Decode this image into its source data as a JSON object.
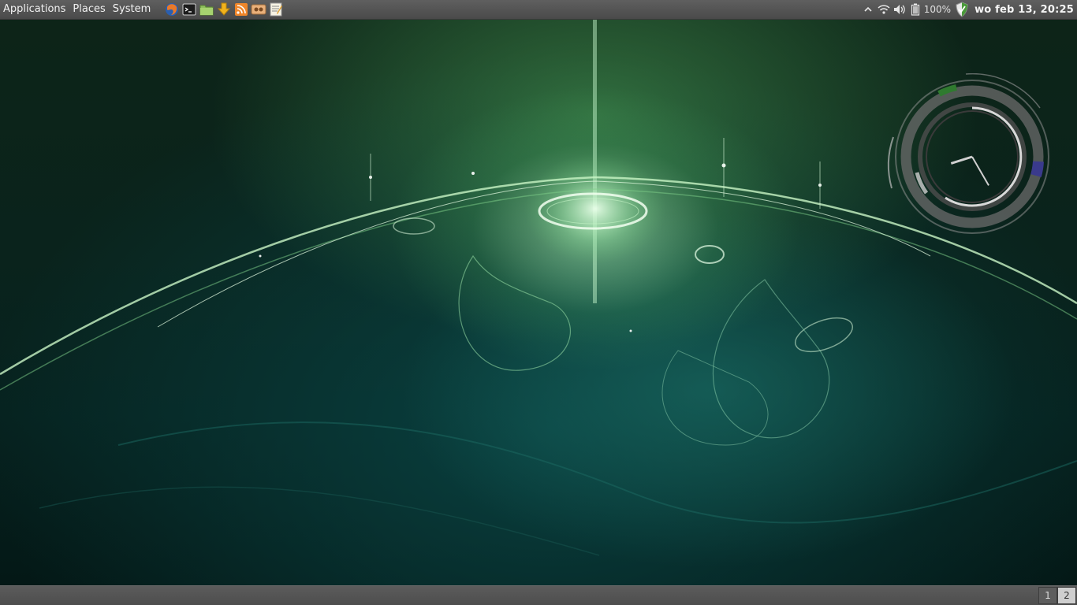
{
  "top_panel": {
    "menus": [
      {
        "label": "Applications"
      },
      {
        "label": "Places"
      },
      {
        "label": "System"
      }
    ],
    "launchers": [
      {
        "icon": "firefox-icon"
      },
      {
        "icon": "terminal-icon"
      },
      {
        "icon": "file-manager-icon"
      },
      {
        "icon": "download-icon"
      },
      {
        "icon": "rss-feed-icon"
      },
      {
        "icon": "image-viewer-icon"
      },
      {
        "icon": "text-editor-icon"
      }
    ],
    "tray": {
      "battery_percent": "100%",
      "clock": "wo feb 13, 20:25"
    }
  },
  "bottom_panel": {
    "workspaces": [
      "1",
      "2"
    ],
    "active_workspace": "2"
  },
  "desktop_clock": {
    "hour": 8,
    "minute": 25
  },
  "colors": {
    "panel": "#555555",
    "accent_green": "#3c8c3c",
    "accent_blue": "#3a3a8c"
  }
}
